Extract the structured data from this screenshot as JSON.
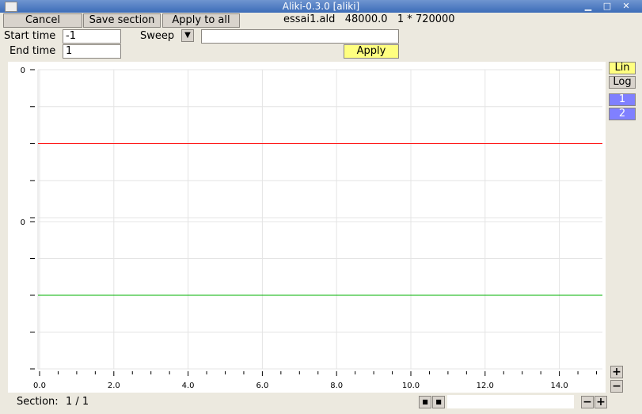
{
  "window": {
    "title": "Aliki-0.3.0  [aliki]"
  },
  "toolbar": {
    "cancel": "Cancel",
    "save_section": "Save section",
    "apply_to_all": "Apply to all",
    "file_info": "essai1.ald   48000.0   1 * 720000"
  },
  "params": {
    "start_label": "Start time",
    "start_value": "-1",
    "end_label": "End time",
    "end_value": "1",
    "sweep_label": "Sweep",
    "sweep_value": "",
    "apply": "Apply"
  },
  "side": {
    "lin": "Lin",
    "log": "Log",
    "channels": [
      "1",
      "2"
    ]
  },
  "plot": {
    "channel_zero_labels": [
      "0",
      "0"
    ],
    "x_ticks": [
      "0.0",
      "2.0",
      "4.0",
      "6.0",
      "8.0",
      "10.0",
      "12.0",
      "14.0"
    ],
    "colors": {
      "channel1": "#ff0000",
      "channel2": "#00b000",
      "apply": "#ffff80",
      "channel_button": "#8080ff"
    }
  },
  "status": {
    "section_label": "Section:",
    "section_value": "1 / 1"
  }
}
